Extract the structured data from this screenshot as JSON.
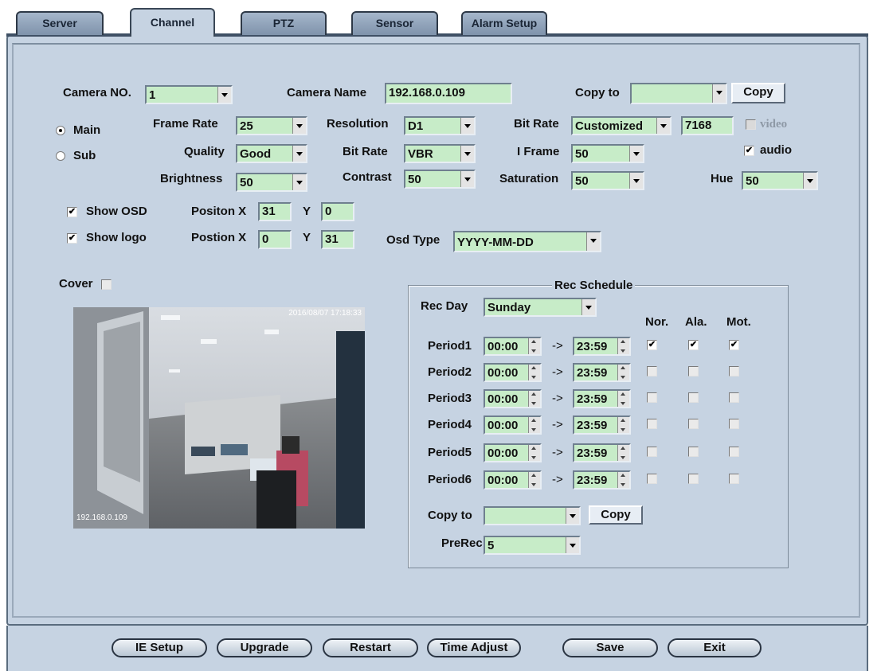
{
  "tabs": [
    "Server",
    "Channel",
    "PTZ",
    "Sensor",
    "Alarm Setup"
  ],
  "camera": {
    "no_label": "Camera NO.",
    "no_value": "1",
    "name_label": "Camera Name",
    "name_value": "192.168.0.109",
    "copy_to_label": "Copy to",
    "copy_to_value": "",
    "copy_button": "Copy"
  },
  "stream": {
    "main_label": "Main",
    "sub_label": "Sub",
    "selected": "Main"
  },
  "settings": {
    "frame_rate_label": "Frame Rate",
    "frame_rate": "25",
    "resolution_label": "Resolution",
    "resolution": "D1",
    "bitrate_label": "Bit Rate",
    "bitrate_mode": "Customized",
    "bitrate_value": "7168",
    "video_label": "video",
    "video_checked": false,
    "quality_label": "Quality",
    "quality": "Good",
    "bitrate_type_label": "Bit Rate",
    "bitrate_type": "VBR",
    "iframe_label": "I Frame",
    "iframe": "50",
    "audio_label": "audio",
    "audio_checked": true,
    "brightness_label": "Brightness",
    "brightness": "50",
    "contrast_label": "Contrast",
    "contrast": "50",
    "saturation_label": "Saturation",
    "saturation": "50",
    "hue_label": "Hue",
    "hue": "50"
  },
  "osd": {
    "show_osd_label": "Show OSD",
    "show_osd": true,
    "pos_label_1": "Positon X",
    "x1": "31",
    "y_label": "Y",
    "y1": "0",
    "show_logo_label": "Show logo",
    "show_logo": true,
    "pos_label_2": "Postion X",
    "x2": "0",
    "y2": "31",
    "osd_type_label": "Osd Type",
    "osd_type": "YYYY-MM-DD"
  },
  "cover": {
    "label": "Cover",
    "checked": false
  },
  "preview": {
    "timestamp": "2016/08/07 17:18:33",
    "ip_overlay": "192.168.0.109"
  },
  "rec_schedule": {
    "title": "Rec Schedule",
    "rec_day_label": "Rec Day",
    "rec_day": "Sunday",
    "col_nor": "Nor.",
    "col_ala": "Ala.",
    "col_mot": "Mot.",
    "arrow": "->",
    "periods": [
      {
        "label": "Period1",
        "start": "00:00",
        "end": "23:59",
        "nor": true,
        "ala": true,
        "mot": true
      },
      {
        "label": "Period2",
        "start": "00:00",
        "end": "23:59",
        "nor": false,
        "ala": false,
        "mot": false
      },
      {
        "label": "Period3",
        "start": "00:00",
        "end": "23:59",
        "nor": false,
        "ala": false,
        "mot": false
      },
      {
        "label": "Period4",
        "start": "00:00",
        "end": "23:59",
        "nor": false,
        "ala": false,
        "mot": false
      },
      {
        "label": "Period5",
        "start": "00:00",
        "end": "23:59",
        "nor": false,
        "ala": false,
        "mot": false
      },
      {
        "label": "Period6",
        "start": "00:00",
        "end": "23:59",
        "nor": false,
        "ala": false,
        "mot": false
      }
    ],
    "copy_to_label": "Copy to",
    "copy_to_value": "",
    "copy_button": "Copy",
    "prerec_label": "PreRec",
    "prerec": "5"
  },
  "footer_buttons": [
    "IE Setup",
    "Upgrade",
    "Restart",
    "Time Adjust",
    "Save",
    "Exit"
  ],
  "colors": {
    "panel": "#c6d3e2",
    "field": "#c7ecc8",
    "tab": "#8ea1b8"
  }
}
